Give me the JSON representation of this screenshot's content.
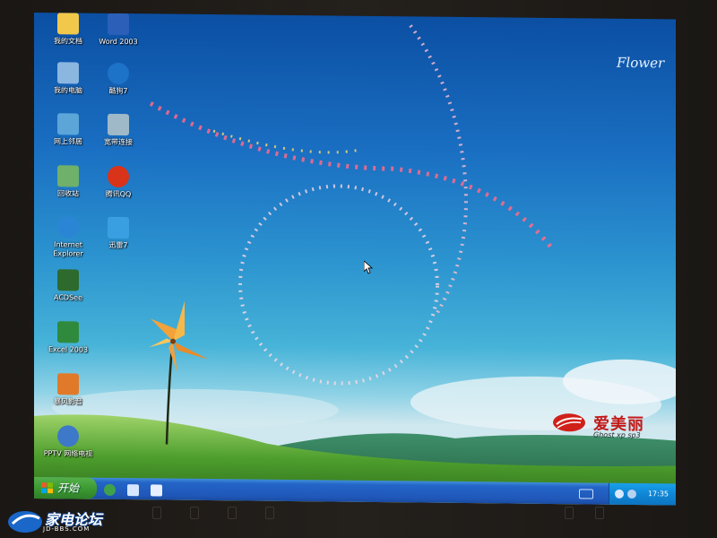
{
  "desktop": {
    "icons": [
      {
        "label": "我的文档",
        "icon": "my-documents-icon",
        "color": "#f2c84b"
      },
      {
        "label": "Word 2003",
        "icon": "word-icon",
        "color": "#2b5fb8"
      },
      {
        "label": "我的电脑",
        "icon": "my-computer-icon",
        "color": "#8ab6e0"
      },
      {
        "label": "酷狗7",
        "icon": "kugou-icon",
        "color": "#1c73c8"
      },
      {
        "label": "网上邻居",
        "icon": "network-places-icon",
        "color": "#5ba5d9"
      },
      {
        "label": "宽带连接",
        "icon": "broadband-connection-icon",
        "color": "#9fb9c9"
      },
      {
        "label": "回收站",
        "icon": "recycle-bin-icon",
        "color": "#6fb06a"
      },
      {
        "label": "腾讯QQ",
        "icon": "qq-icon",
        "color": "#d9331a"
      },
      {
        "label": "Internet Explorer",
        "icon": "internet-explorer-icon",
        "color": "#2a86d4"
      },
      {
        "label": "迅雷7",
        "icon": "xunlei-icon",
        "color": "#3a9fe0"
      },
      {
        "label": "ACDSee",
        "icon": "acdsee-icon",
        "color": "#2e6a2e"
      },
      {
        "label": "Excel 2003",
        "icon": "excel-icon",
        "color": "#2f8a3d"
      },
      {
        "label": "暴风影音",
        "icon": "baofeng-icon",
        "color": "#e07a2a"
      },
      {
        "label": "PPTV 网络电视",
        "icon": "pptv-icon",
        "color": "#3e78c9"
      }
    ]
  },
  "wallpaper": {
    "logo_text": "Flower",
    "brand_name": "爱美丽",
    "brand_sub": "Ghost xp sp3",
    "brand_color": "#c21a1a"
  },
  "taskbar": {
    "start_label": "开始",
    "clock": "17:35",
    "quick_launch": [
      "ie-quick-icon",
      "media-quick-icon",
      "desktop-quick-icon"
    ]
  },
  "watermark": {
    "name": "家电论坛",
    "url": "JD-BBS.COM"
  }
}
